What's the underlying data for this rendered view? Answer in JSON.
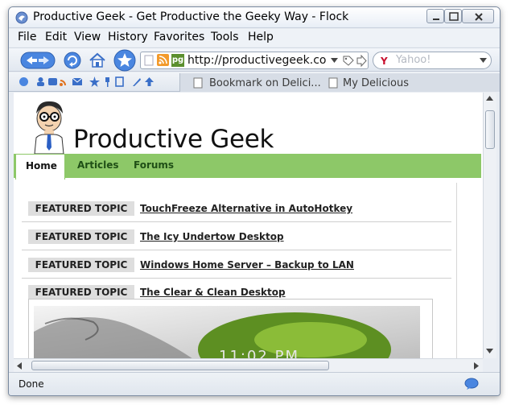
{
  "window": {
    "title": "Productive Geek - Get Productive the Geeky Way - Flock"
  },
  "menu": {
    "items": [
      "File",
      "Edit",
      "View",
      "History",
      "Favorites",
      "Tools",
      "Help"
    ]
  },
  "navbar": {
    "url": "http://productivegeek.co",
    "search_placeholder": "Yahoo!",
    "site_badge": "pg"
  },
  "bookmarks": {
    "items": [
      "Bookmark on Delici...",
      "My Delicious"
    ]
  },
  "page": {
    "site_title": "Productive Geek",
    "nav": [
      "Home",
      "Articles",
      "Forums"
    ],
    "featured_label": "FEATURED TOPIC",
    "topics": [
      "TouchFreeze Alternative in AutoHotkey",
      "The Icy Undertow Desktop",
      "Windows Home Server – Backup to LAN",
      "The Clear & Clean Desktop"
    ],
    "preview_clock": "11:02 PM"
  },
  "status": {
    "text": "Done"
  },
  "colors": {
    "nav_green": "#8dc868",
    "link_blue": "#2f6fce"
  }
}
